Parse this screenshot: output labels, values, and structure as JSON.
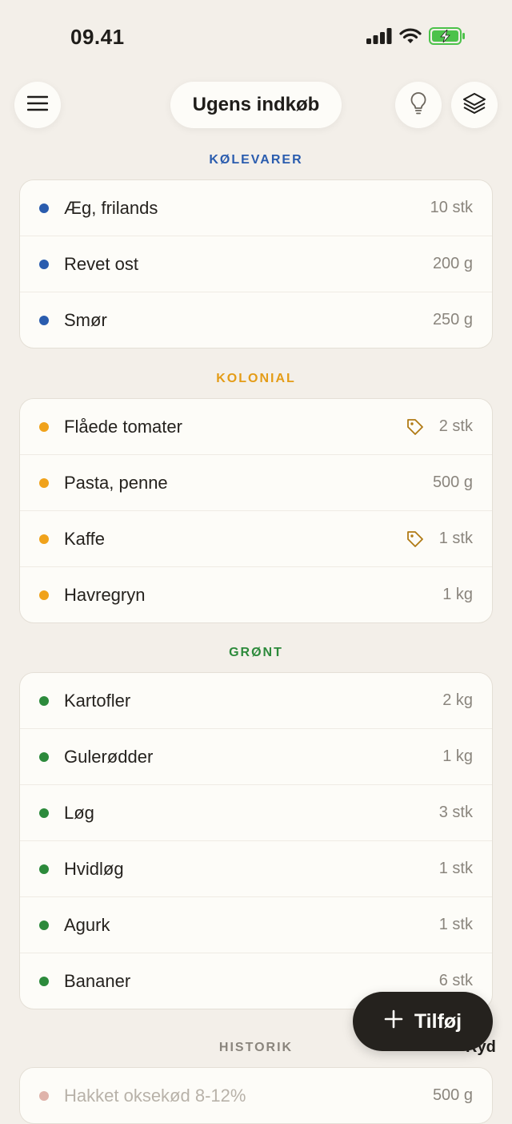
{
  "status_bar": {
    "time": "09.41"
  },
  "header": {
    "title": "Ugens indkøb"
  },
  "sections": [
    {
      "title": "KØLEVARER",
      "color": "#2a5cae",
      "dot_color": "#2a5cae",
      "items": [
        {
          "name": "Æg, frilands",
          "qty": "10 stk"
        },
        {
          "name": "Revet ost",
          "qty": "200 g"
        },
        {
          "name": "Smør",
          "qty": "250 g"
        }
      ]
    },
    {
      "title": "KOLONIAL",
      "color": "#e49c17",
      "dot_color": "#f0a21b",
      "items": [
        {
          "name": "Flåede tomater",
          "qty": "2 stk",
          "tag": true
        },
        {
          "name": "Pasta, penne",
          "qty": "500 g"
        },
        {
          "name": "Kaffe",
          "qty": "1 stk",
          "tag": true
        },
        {
          "name": "Havregryn",
          "qty": "1 kg"
        }
      ]
    },
    {
      "title": "GRØNT",
      "color": "#2c8a3b",
      "dot_color": "#2c8a3b",
      "items": [
        {
          "name": "Kartofler",
          "qty": "2 kg"
        },
        {
          "name": "Gulerødder",
          "qty": "1 kg"
        },
        {
          "name": "Løg",
          "qty": "3 stk"
        },
        {
          "name": "Hvidløg",
          "qty": "1 stk"
        },
        {
          "name": "Agurk",
          "qty": "1 stk"
        },
        {
          "name": "Bananer",
          "qty": "6 stk"
        }
      ]
    }
  ],
  "history": {
    "title": "HISTORIK",
    "color": "#8a857d",
    "dot_color": "#dfb3aa",
    "items": [
      {
        "name": "Hakket oksekød 8-12%",
        "qty": "500 g"
      }
    ]
  },
  "fab": {
    "label": "Tilføj"
  },
  "clear_label": "Ryd",
  "icons": {
    "menu": "menu-icon",
    "lightbulb": "lightbulb-icon",
    "layers": "layers-icon",
    "tag": "tag-icon",
    "plus": "plus-icon"
  }
}
